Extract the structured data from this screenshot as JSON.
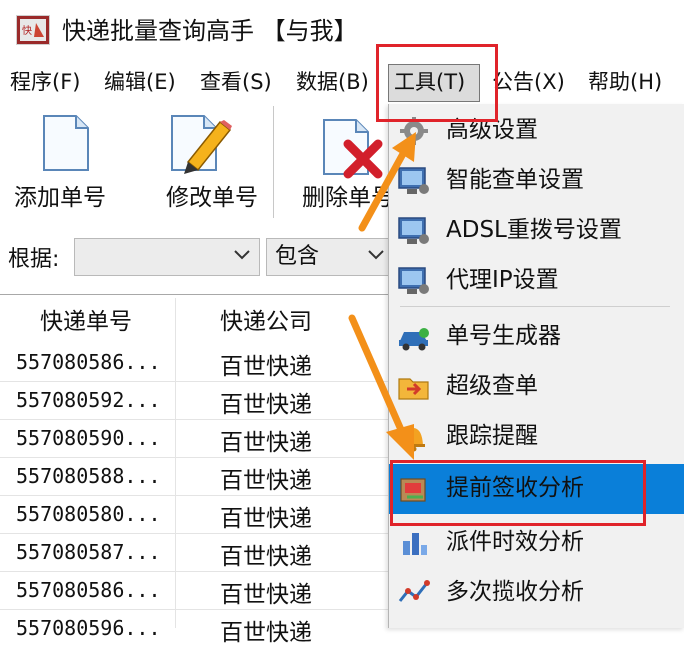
{
  "window": {
    "title": "快递批量查询高手 【与我】"
  },
  "menubar": {
    "items": [
      {
        "label": "程序(F)"
      },
      {
        "label": "编辑(E)"
      },
      {
        "label": "查看(S)"
      },
      {
        "label": "数据(B)"
      },
      {
        "label": "工具(T)"
      },
      {
        "label": "公告(X)"
      },
      {
        "label": "帮助(H)"
      }
    ]
  },
  "toolbar": {
    "add_label": "添加单号",
    "edit_label": "修改单号",
    "delete_label": "删除单号"
  },
  "filter": {
    "label": "根据:",
    "field_value": "",
    "match_value": "包含"
  },
  "table": {
    "headers": [
      "快递单号",
      "快递公司"
    ],
    "rows": [
      {
        "number": "557080586...",
        "company": "百世快递"
      },
      {
        "number": "557080592...",
        "company": "百世快递"
      },
      {
        "number": "557080590...",
        "company": "百世快递"
      },
      {
        "number": "557080588...",
        "company": "百世快递"
      },
      {
        "number": "557080580...",
        "company": "百世快递"
      },
      {
        "number": "557080587...",
        "company": "百世快递"
      },
      {
        "number": "557080586...",
        "company": "百世快递"
      },
      {
        "number": "557080596...",
        "company": "百世快递"
      }
    ]
  },
  "tools_menu": {
    "items": [
      {
        "label": "高级设置",
        "icon": "gear-icon"
      },
      {
        "label": "智能查单设置",
        "icon": "monitor-settings-icon"
      },
      {
        "label": "ADSL重拨号设置",
        "icon": "monitor-settings-icon"
      },
      {
        "label": "代理IP设置",
        "icon": "monitor-settings-icon"
      },
      {
        "label": "单号生成器",
        "icon": "car-icon"
      },
      {
        "label": "超级查单",
        "icon": "folder-arrow-icon"
      },
      {
        "label": "跟踪提醒",
        "icon": "bell-icon"
      },
      {
        "label": "提前签收分析",
        "icon": "package-analysis-icon",
        "selected": true
      },
      {
        "label": "派件时效分析",
        "icon": "bar-chart-icon"
      },
      {
        "label": "多次揽收分析",
        "icon": "line-chart-icon"
      }
    ]
  },
  "colors": {
    "selection": "#0a7fd9",
    "annotation_red": "#e0232a",
    "annotation_orange": "#f39019"
  }
}
